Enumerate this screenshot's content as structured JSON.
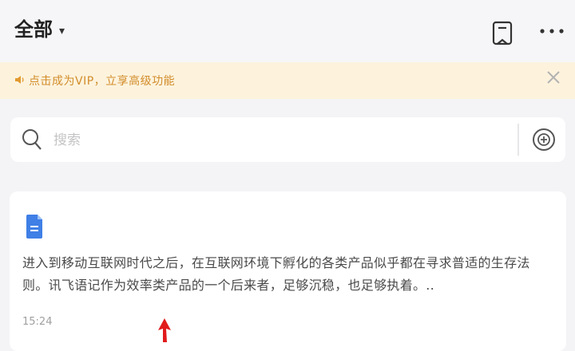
{
  "header": {
    "title": "全部",
    "caret": "▾",
    "icons": {
      "bookmark": "bookmark-icon",
      "more": "more-icon"
    }
  },
  "banner": {
    "text": "点击成为VIP，立享高级功能",
    "icon": "speaker-icon",
    "close_icon": "close-icon"
  },
  "search": {
    "placeholder": "搜索",
    "value": "",
    "icon": "search-icon",
    "add_icon": "add-note-icon"
  },
  "notes": [
    {
      "icon": "document-icon",
      "content": "进入到移动互联网时代之后，在互联网环境下孵化的各类产品似乎都在寻求普适的生存法则。讯飞语记作为效率类产品的一个后来者，足够沉稳，也足够执着。..",
      "time": "15:24"
    }
  ],
  "colors": {
    "background": "#f4f4f6",
    "banner_bg": "#fdf3dd",
    "banner_text": "#d28c2a",
    "doc_icon": "#3f7fe6",
    "cursor": "#e11b1b"
  }
}
